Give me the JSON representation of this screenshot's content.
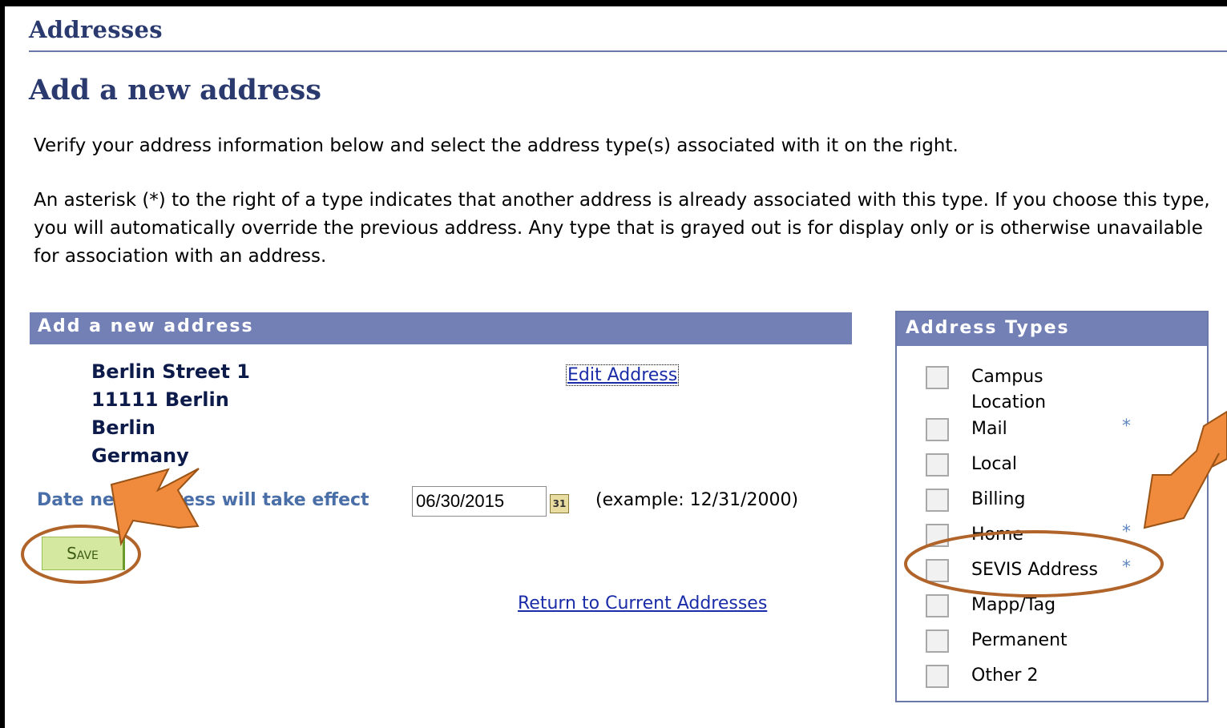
{
  "header": {
    "section_title": "Addresses",
    "page_title": "Add a new address"
  },
  "instructions": {
    "line1": "Verify your address information below and select the address type(s) associated with it on the right.",
    "line2": "An asterisk (*) to the right of a type indicates that another address is already associated with this type. If you choose this type, you will automatically override the previous address. Any type that is grayed out is for display only or is otherwise unavailable for association with an address."
  },
  "address_panel": {
    "header": "Add a new address",
    "address_lines": [
      "Berlin Street 1",
      "11111 Berlin",
      "Berlin",
      "Germany"
    ],
    "edit_link": "Edit Address",
    "date_label": "Date new address will take effect",
    "date_value": "06/30/2015",
    "calendar_icon": "calendar-icon",
    "calendar_icon_text": "31",
    "date_example": "(example: 12/31/2000)",
    "save_label": "Save",
    "return_link": "Return to Current Addresses"
  },
  "address_types": {
    "header": "Address Types",
    "items": [
      {
        "label": "Campus",
        "label2": "Location",
        "checked": false,
        "star": ""
      },
      {
        "label": "Mail",
        "checked": false,
        "star": "*"
      },
      {
        "label": "Local",
        "checked": false,
        "star": ""
      },
      {
        "label": "Billing",
        "checked": false,
        "star": ""
      },
      {
        "label": "Home",
        "checked": false,
        "star": "*"
      },
      {
        "label": "SEVIS Address",
        "checked": false,
        "star": "*"
      },
      {
        "label": "Mapp/Tag",
        "checked": false,
        "star": ""
      },
      {
        "label": "Permanent",
        "checked": false,
        "star": ""
      },
      {
        "label": "Other 2",
        "checked": false,
        "star": ""
      }
    ]
  },
  "annotations": {
    "arrow_color": "#f08a3c",
    "ellipse_color": "#b0642a"
  }
}
